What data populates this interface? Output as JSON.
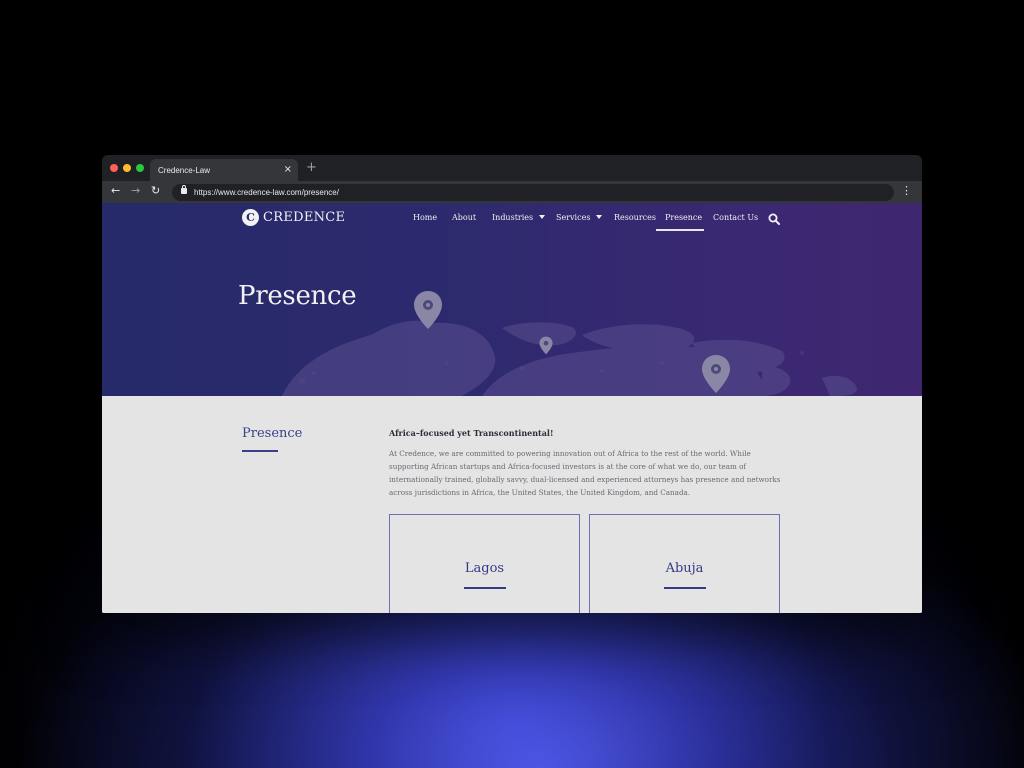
{
  "browser": {
    "tab_title": "Credence-Law",
    "tab_close": "×",
    "new_tab": "+",
    "url": "https://www.credence-law.com/presence/",
    "back_icon": "arrow-left-icon",
    "forward_icon": "arrow-right-icon",
    "reload_icon": "reload-icon",
    "menu_icon": "kebab-menu-icon"
  },
  "site": {
    "logo_mark": "C",
    "logo_text": "CREDENCE",
    "nav": {
      "home": "Home",
      "about": "About",
      "industries": "Industries",
      "services": "Services",
      "resources": "Resources",
      "presence": "Presence",
      "contact": "Contact Us"
    },
    "active_nav": "Presence"
  },
  "hero": {
    "title": "Presence"
  },
  "content": {
    "side_title": "Presence",
    "lead": "Africa–focused yet Transcontinental!",
    "paragraph": "At Credence, we are committed to powering innovation out of Africa to the rest of the world. While supporting African startups and Africa-focused investors is at the core of what we do, our team of internationally trained, globally savvy, dual-licensed and experienced attorneys has presence and networks across jurisdictions in Africa, the United States, the United Kingdom, and Canada.",
    "offices": [
      {
        "city": "Lagos"
      },
      {
        "city": "Abuja"
      }
    ]
  },
  "colors": {
    "hero_start": "#262a6a",
    "hero_end": "#3e2770",
    "accent": "#3a3f8a",
    "content_bg": "#e4e4e4"
  }
}
